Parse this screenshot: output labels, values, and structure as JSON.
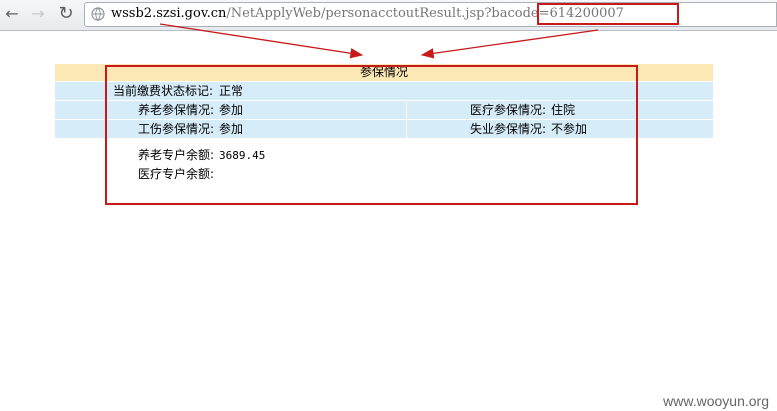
{
  "browser": {
    "nav": {
      "back_icon": "arrow-left-icon",
      "forward_icon": "arrow-right-icon",
      "reload_icon": "reload-icon"
    },
    "url": {
      "host": "wssb2.szsi.gov.cn",
      "path": "/NetApplyWeb/personacctoutResult.jsp?",
      "query": "bacode=614200007"
    }
  },
  "panel": {
    "title": "参保情况",
    "status_label": "当前缴费状态标记:",
    "status_value": "正常",
    "pension_label": "养老参保情况:",
    "pension_value": "参加",
    "medical_label": "医疗参保情况:",
    "medical_value": "住院",
    "injury_label": "工伤参保情况:",
    "injury_value": "参加",
    "unemployment_label": "失业参保情况:",
    "unemployment_value": "不参加",
    "pension_balance_label": "养老专户余额:",
    "pension_balance_value": "3689.45",
    "medical_balance_label": "医疗专户余额:",
    "medical_balance_value": ""
  },
  "annotation": {
    "highlight_color": "#c81a1a"
  },
  "watermark": "www.wooyun.org"
}
